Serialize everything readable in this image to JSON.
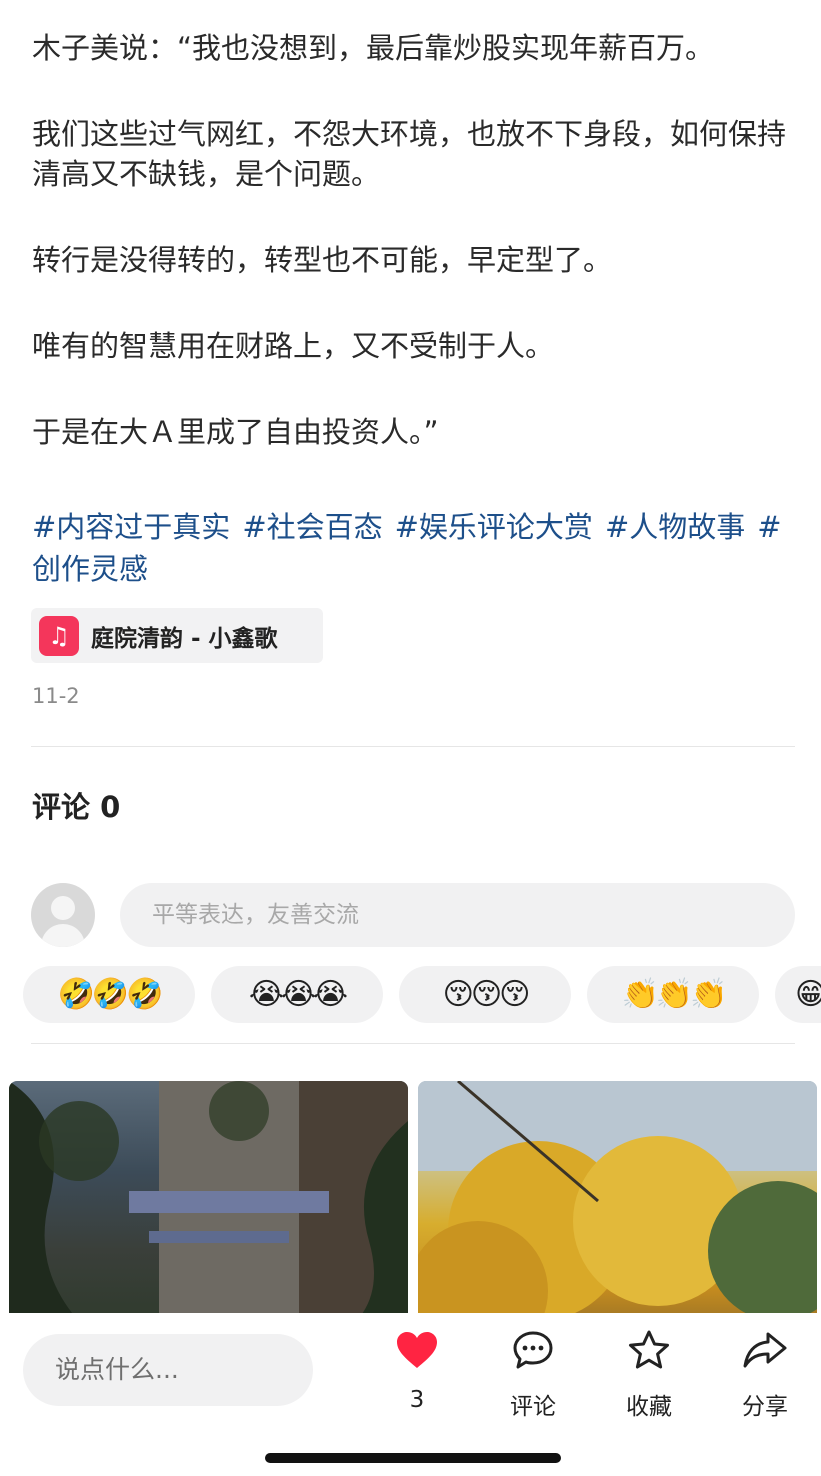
{
  "post": {
    "paragraphs": [
      "木子美说：“我也没想到，最后靠炒股实现年薪百万。",
      "我们这些过气网红，不怨大环境，也放不下身段，如何保持清高又不缺钱，是个问题。",
      "转行是没得转的，转型也不可能，早定型了。",
      "唯有的智慧用在财路上，又不受制于人。",
      "于是在大Ａ里成了自由投资人。”"
    ],
    "tags": [
      "#内容过于真实",
      "#社会百态",
      "#娱乐评论大赏",
      "#人物故事",
      "#创作灵感"
    ],
    "music": {
      "icon": "music-note-icon",
      "label": "庭院清韵 - 小鑫歌"
    },
    "date": "11-2"
  },
  "comments": {
    "title": "评论 0",
    "input_placeholder": "平等表达，友善交流",
    "quick_emojis": [
      "🤣🤣🤣",
      "😭😭😭",
      "😚😚😚",
      "👏👏👏",
      "😁"
    ]
  },
  "bottom_bar": {
    "input_placeholder": "说点什么...",
    "like": {
      "icon": "heart-icon",
      "label": "3",
      "color": "#ff2442"
    },
    "comment": {
      "icon": "comment-bubble-icon",
      "label": "评论"
    },
    "favorite": {
      "icon": "star-icon",
      "label": "收藏"
    },
    "share": {
      "icon": "share-arrow-icon",
      "label": "分享"
    }
  }
}
